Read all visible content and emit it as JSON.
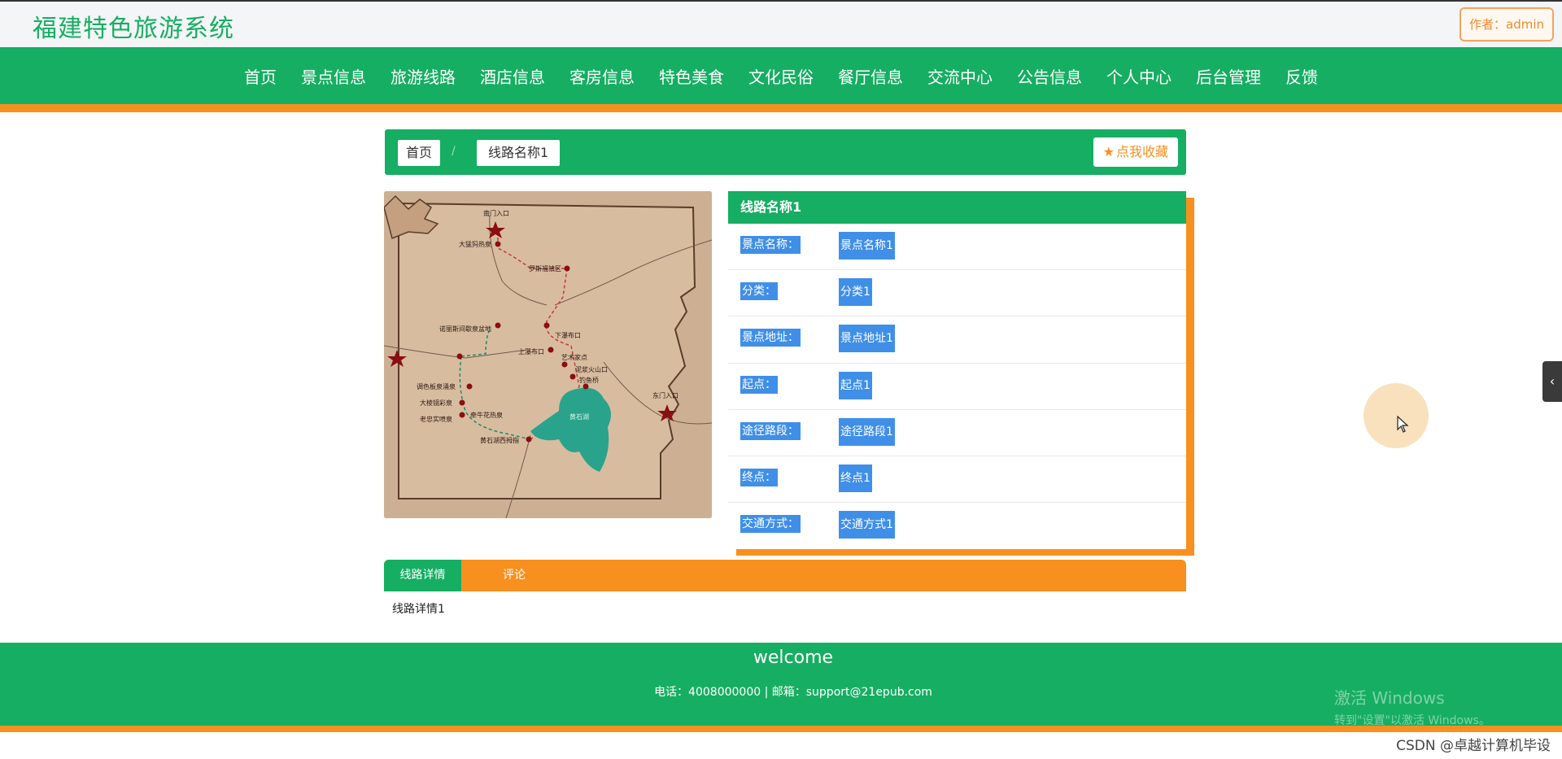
{
  "header": {
    "site_title": "福建特色旅游系统",
    "author_label": "作者：admin"
  },
  "nav": {
    "items": [
      "首页",
      "景点信息",
      "旅游线路",
      "酒店信息",
      "客房信息",
      "特色美食",
      "文化民俗",
      "餐厅信息",
      "交流中心",
      "公告信息",
      "个人中心",
      "后台管理",
      "反馈"
    ]
  },
  "breadcrumb": {
    "home": "首页",
    "separator": "/",
    "current": "线路名称1",
    "collect_label": "点我收藏"
  },
  "map": {
    "labels": [
      "南门入口",
      "大猛犸热泉",
      "罗斯福镇区",
      "诺丽斯间歇泉盆地",
      "下瀑布口",
      "上瀑布口",
      "艺术家点",
      "泥浆火山口",
      "钓鱼桥",
      "东门入口",
      "调色板泉涌泉",
      "大棱镜彩泉",
      "牵牛花热泉",
      "老忠实喷泉",
      "黄石湖西拇指",
      "黄石湖"
    ]
  },
  "detail": {
    "title": "线路名称1",
    "rows": [
      {
        "label": "景点名称：",
        "value": "景点名称1"
      },
      {
        "label": "分类：",
        "value": "分类1"
      },
      {
        "label": "景点地址：",
        "value": "景点地址1"
      },
      {
        "label": "起点：",
        "value": "起点1"
      },
      {
        "label": "途径路段：",
        "value": "途径路段1"
      },
      {
        "label": "终点：",
        "value": "终点1"
      },
      {
        "label": "交通方式：",
        "value": "交通方式1"
      }
    ]
  },
  "tabs": {
    "details": "线路详情",
    "comments": "评论",
    "details_content": "线路详情1"
  },
  "footer": {
    "welcome": "welcome",
    "contact": "电话：4008000000 | 邮箱：support@21epub.com",
    "windows_title": "激活 Windows",
    "windows_sub": "转到\"设置\"以激活 Windows。"
  },
  "overlay": {
    "watermark": "CSDN @卓越计算机毕设",
    "side_arrow": "‹"
  },
  "colors": {
    "green": "#16ae62",
    "orange": "#f7901e",
    "selection_blue": "#3f8fe8"
  }
}
